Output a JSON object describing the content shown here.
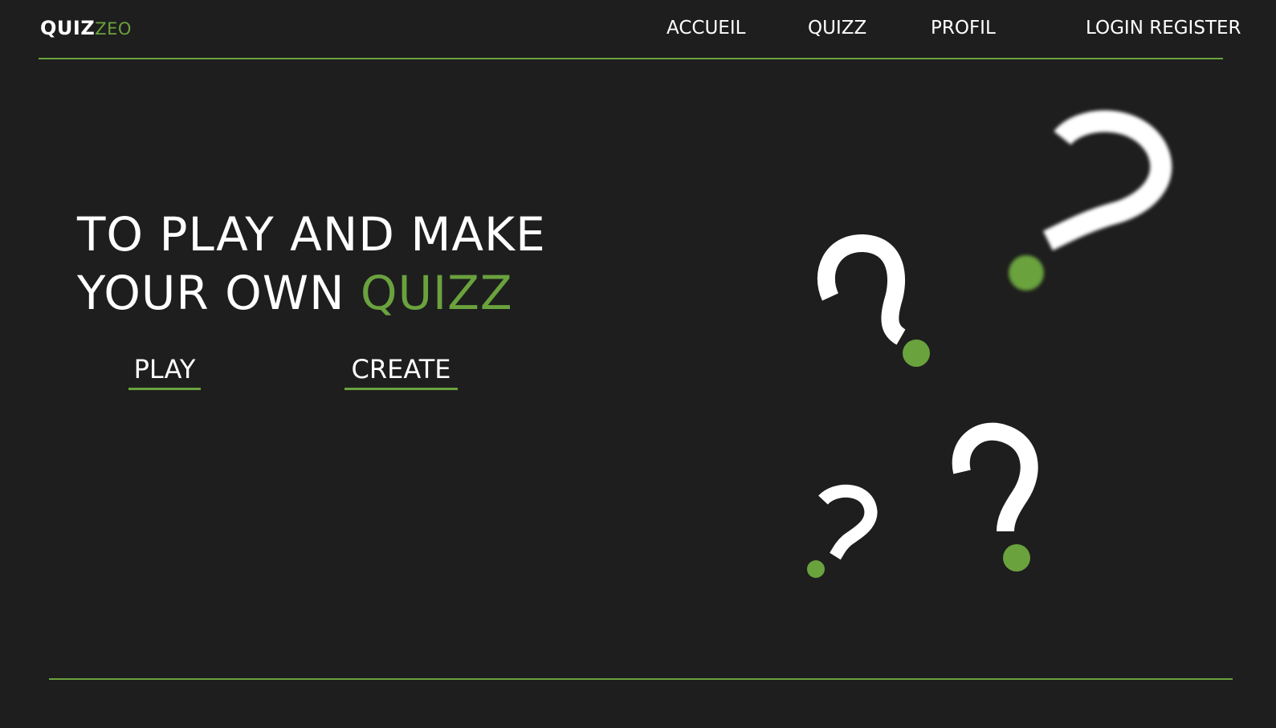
{
  "header": {
    "logo_main": "QUIZ",
    "logo_accent": "ZEO",
    "nav": {
      "home": "ACCUEIL",
      "quizz": "QUIZZ",
      "profile": "PROFIL",
      "auth": "LOGIN REGISTER"
    }
  },
  "hero": {
    "title_line1": "TO PLAY AND MAKE",
    "title_line2_prefix": "YOUR OWN ",
    "title_line2_accent": "QUIZZ",
    "play_label": "PLAY",
    "create_label": "CREATE"
  },
  "colors": {
    "background": "#1e1e1e",
    "accent": "#6aa23e",
    "text": "#ffffff"
  },
  "decorations": {
    "icons": [
      "question-mark-icon",
      "question-mark-icon",
      "question-mark-icon",
      "question-mark-icon"
    ]
  }
}
